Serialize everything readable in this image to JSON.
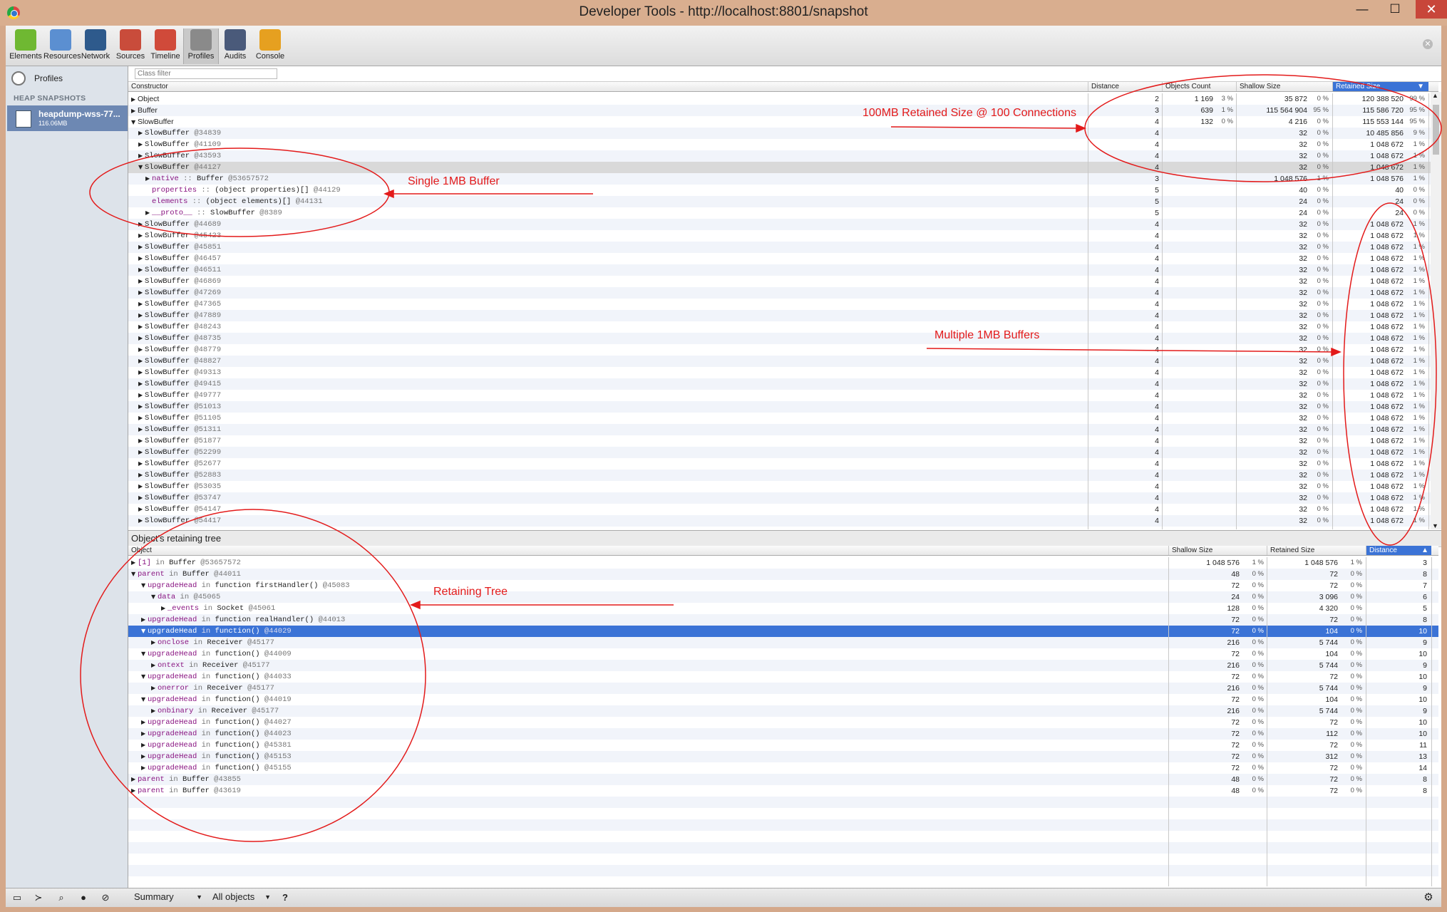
{
  "window": {
    "title": "Developer Tools - http://localhost:8801/snapshot",
    "controls": {
      "minimize": "—",
      "maximize": "☐",
      "close": "✕"
    }
  },
  "toolbar": {
    "items": [
      {
        "label": "Elements",
        "icon": "elements-icon",
        "color": "#6fb832"
      },
      {
        "label": "Resources",
        "icon": "resources-icon",
        "color": "#5b8fd1"
      },
      {
        "label": "Network",
        "icon": "network-icon",
        "color": "#2e5a8c"
      },
      {
        "label": "Sources",
        "icon": "sources-icon",
        "color": "#c94c3b"
      },
      {
        "label": "Timeline",
        "icon": "timeline-icon",
        "color": "#d04a3a"
      },
      {
        "label": "Profiles",
        "icon": "profiles-icon",
        "color": "#8a8a8a"
      },
      {
        "label": "Audits",
        "icon": "audits-icon",
        "color": "#4a5a7a"
      },
      {
        "label": "Console",
        "icon": "console-icon",
        "color": "#e6a020"
      }
    ],
    "active": "Profiles",
    "close": "✕"
  },
  "sidebar": {
    "profiles_label": "Profiles",
    "heading": "HEAP SNAPSHOTS",
    "snapshot": {
      "name": "heapdump-wss-77...",
      "size": "116.06MB"
    }
  },
  "filter": {
    "placeholder": "Class filter"
  },
  "summary": {
    "columns": {
      "constructor": "Constructor",
      "distance": "Distance",
      "count": "Objects Count",
      "shallow": "Shallow Size",
      "retained": "Retained Size",
      "sort_arrow": "▼"
    },
    "rows": [
      {
        "arrow": "▶",
        "indent": 0,
        "name": "Object",
        "mono": false,
        "distance": "2",
        "count": "1 169",
        "count_pct": "3 %",
        "shallow": "35 872",
        "shallow_pct": "0 %",
        "retained": "120 388 520",
        "retained_pct": "99 %"
      },
      {
        "arrow": "▶",
        "indent": 0,
        "name": "Buffer",
        "mono": false,
        "distance": "3",
        "count": "639",
        "count_pct": "1 %",
        "shallow": "115 564 904",
        "shallow_pct": "95 %",
        "retained": "115 586 720",
        "retained_pct": "95 %"
      },
      {
        "arrow": "▼",
        "indent": 0,
        "name": "SlowBuffer",
        "mono": false,
        "distance": "4",
        "count": "132",
        "count_pct": "0 %",
        "shallow": "4 216",
        "shallow_pct": "0 %",
        "retained": "115 553 144",
        "retained_pct": "95 %"
      },
      {
        "arrow": "▶",
        "indent": 1,
        "name": "SlowBuffer",
        "id": "@34839",
        "mono": true,
        "distance": "4",
        "shallow": "32",
        "shallow_pct": "0 %",
        "retained": "10 485 856",
        "retained_pct": "9 %"
      },
      {
        "arrow": "▶",
        "indent": 1,
        "name": "SlowBuffer",
        "id": "@41109",
        "mono": true,
        "distance": "4",
        "shallow": "32",
        "shallow_pct": "0 %",
        "retained": "1 048 672",
        "retained_pct": "1 %"
      },
      {
        "arrow": "▶",
        "indent": 1,
        "name": "SlowBuffer",
        "id": "@43593",
        "mono": true,
        "distance": "4",
        "shallow": "32",
        "shallow_pct": "0 %",
        "retained": "1 048 672",
        "retained_pct": "1 %"
      },
      {
        "arrow": "▼",
        "indent": 1,
        "name": "SlowBuffer",
        "id": "@44127",
        "mono": true,
        "highlight": true,
        "distance": "4",
        "shallow": "32",
        "shallow_pct": "0 %",
        "retained": "1 048 672",
        "retained_pct": "1 %"
      },
      {
        "arrow": "▶",
        "indent": 2,
        "prop": "native",
        "sep": " :: ",
        "name": "Buffer",
        "id": "@53657572",
        "mono": true,
        "dim": true,
        "distance": "3",
        "shallow": "1 048 576",
        "shallow_pct": "1 %",
        "retained": "1 048 576",
        "retained_pct": "1 %"
      },
      {
        "arrow": "",
        "indent": 2,
        "prop": "properties",
        "sep": " :: ",
        "name": "(object properties)[]",
        "id": "@44129",
        "mono": true,
        "dim": true,
        "distance": "5",
        "shallow": "40",
        "shallow_pct": "0 %",
        "retained": "40",
        "retained_pct": "0 %"
      },
      {
        "arrow": "",
        "indent": 2,
        "prop": "elements",
        "sep": " :: ",
        "name": "(object elements)[]",
        "id": "@44131",
        "mono": true,
        "dim": true,
        "distance": "5",
        "shallow": "24",
        "shallow_pct": "0 %",
        "retained": "24",
        "retained_pct": "0 %"
      },
      {
        "arrow": "▶",
        "indent": 2,
        "prop": "__proto__",
        "sep": " :: ",
        "name": "SlowBuffer",
        "id": "@8389",
        "mono": true,
        "dim": true,
        "distance": "5",
        "shallow": "24",
        "shallow_pct": "0 %",
        "retained": "24",
        "retained_pct": "0 %"
      },
      {
        "arrow": "▶",
        "indent": 1,
        "name": "SlowBuffer",
        "id": "@44689",
        "mono": true,
        "distance": "4",
        "shallow": "32",
        "shallow_pct": "0 %",
        "retained": "1 048 672",
        "retained_pct": "1 %"
      },
      {
        "arrow": "▶",
        "indent": 1,
        "name": "SlowBuffer",
        "id": "@45423",
        "mono": true,
        "distance": "4",
        "shallow": "32",
        "shallow_pct": "0 %",
        "retained": "1 048 672",
        "retained_pct": "1 %"
      },
      {
        "arrow": "▶",
        "indent": 1,
        "name": "SlowBuffer",
        "id": "@45851",
        "mono": true,
        "distance": "4",
        "shallow": "32",
        "shallow_pct": "0 %",
        "retained": "1 048 672",
        "retained_pct": "1 %"
      },
      {
        "arrow": "▶",
        "indent": 1,
        "name": "SlowBuffer",
        "id": "@46457",
        "mono": true,
        "distance": "4",
        "shallow": "32",
        "shallow_pct": "0 %",
        "retained": "1 048 672",
        "retained_pct": "1 %"
      },
      {
        "arrow": "▶",
        "indent": 1,
        "name": "SlowBuffer",
        "id": "@46511",
        "mono": true,
        "distance": "4",
        "shallow": "32",
        "shallow_pct": "0 %",
        "retained": "1 048 672",
        "retained_pct": "1 %"
      },
      {
        "arrow": "▶",
        "indent": 1,
        "name": "SlowBuffer",
        "id": "@46869",
        "mono": true,
        "distance": "4",
        "shallow": "32",
        "shallow_pct": "0 %",
        "retained": "1 048 672",
        "retained_pct": "1 %"
      },
      {
        "arrow": "▶",
        "indent": 1,
        "name": "SlowBuffer",
        "id": "@47269",
        "mono": true,
        "distance": "4",
        "shallow": "32",
        "shallow_pct": "0 %",
        "retained": "1 048 672",
        "retained_pct": "1 %"
      },
      {
        "arrow": "▶",
        "indent": 1,
        "name": "SlowBuffer",
        "id": "@47365",
        "mono": true,
        "distance": "4",
        "shallow": "32",
        "shallow_pct": "0 %",
        "retained": "1 048 672",
        "retained_pct": "1 %"
      },
      {
        "arrow": "▶",
        "indent": 1,
        "name": "SlowBuffer",
        "id": "@47889",
        "mono": true,
        "distance": "4",
        "shallow": "32",
        "shallow_pct": "0 %",
        "retained": "1 048 672",
        "retained_pct": "1 %"
      },
      {
        "arrow": "▶",
        "indent": 1,
        "name": "SlowBuffer",
        "id": "@48243",
        "mono": true,
        "distance": "4",
        "shallow": "32",
        "shallow_pct": "0 %",
        "retained": "1 048 672",
        "retained_pct": "1 %"
      },
      {
        "arrow": "▶",
        "indent": 1,
        "name": "SlowBuffer",
        "id": "@48735",
        "mono": true,
        "distance": "4",
        "shallow": "32",
        "shallow_pct": "0 %",
        "retained": "1 048 672",
        "retained_pct": "1 %"
      },
      {
        "arrow": "▶",
        "indent": 1,
        "name": "SlowBuffer",
        "id": "@48779",
        "mono": true,
        "distance": "4",
        "shallow": "32",
        "shallow_pct": "0 %",
        "retained": "1 048 672",
        "retained_pct": "1 %"
      },
      {
        "arrow": "▶",
        "indent": 1,
        "name": "SlowBuffer",
        "id": "@48827",
        "mono": true,
        "distance": "4",
        "shallow": "32",
        "shallow_pct": "0 %",
        "retained": "1 048 672",
        "retained_pct": "1 %"
      },
      {
        "arrow": "▶",
        "indent": 1,
        "name": "SlowBuffer",
        "id": "@49313",
        "mono": true,
        "distance": "4",
        "shallow": "32",
        "shallow_pct": "0 %",
        "retained": "1 048 672",
        "retained_pct": "1 %"
      },
      {
        "arrow": "▶",
        "indent": 1,
        "name": "SlowBuffer",
        "id": "@49415",
        "mono": true,
        "distance": "4",
        "shallow": "32",
        "shallow_pct": "0 %",
        "retained": "1 048 672",
        "retained_pct": "1 %"
      },
      {
        "arrow": "▶",
        "indent": 1,
        "name": "SlowBuffer",
        "id": "@49777",
        "mono": true,
        "distance": "4",
        "shallow": "32",
        "shallow_pct": "0 %",
        "retained": "1 048 672",
        "retained_pct": "1 %"
      },
      {
        "arrow": "▶",
        "indent": 1,
        "name": "SlowBuffer",
        "id": "@51013",
        "mono": true,
        "distance": "4",
        "shallow": "32",
        "shallow_pct": "0 %",
        "retained": "1 048 672",
        "retained_pct": "1 %"
      },
      {
        "arrow": "▶",
        "indent": 1,
        "name": "SlowBuffer",
        "id": "@51105",
        "mono": true,
        "distance": "4",
        "shallow": "32",
        "shallow_pct": "0 %",
        "retained": "1 048 672",
        "retained_pct": "1 %"
      },
      {
        "arrow": "▶",
        "indent": 1,
        "name": "SlowBuffer",
        "id": "@51311",
        "mono": true,
        "distance": "4",
        "shallow": "32",
        "shallow_pct": "0 %",
        "retained": "1 048 672",
        "retained_pct": "1 %"
      },
      {
        "arrow": "▶",
        "indent": 1,
        "name": "SlowBuffer",
        "id": "@51877",
        "mono": true,
        "distance": "4",
        "shallow": "32",
        "shallow_pct": "0 %",
        "retained": "1 048 672",
        "retained_pct": "1 %"
      },
      {
        "arrow": "▶",
        "indent": 1,
        "name": "SlowBuffer",
        "id": "@52299",
        "mono": true,
        "distance": "4",
        "shallow": "32",
        "shallow_pct": "0 %",
        "retained": "1 048 672",
        "retained_pct": "1 %"
      },
      {
        "arrow": "▶",
        "indent": 1,
        "name": "SlowBuffer",
        "id": "@52677",
        "mono": true,
        "distance": "4",
        "shallow": "32",
        "shallow_pct": "0 %",
        "retained": "1 048 672",
        "retained_pct": "1 %"
      },
      {
        "arrow": "▶",
        "indent": 1,
        "name": "SlowBuffer",
        "id": "@52883",
        "mono": true,
        "distance": "4",
        "shallow": "32",
        "shallow_pct": "0 %",
        "retained": "1 048 672",
        "retained_pct": "1 %"
      },
      {
        "arrow": "▶",
        "indent": 1,
        "name": "SlowBuffer",
        "id": "@53035",
        "mono": true,
        "distance": "4",
        "shallow": "32",
        "shallow_pct": "0 %",
        "retained": "1 048 672",
        "retained_pct": "1 %"
      },
      {
        "arrow": "▶",
        "indent": 1,
        "name": "SlowBuffer",
        "id": "@53747",
        "mono": true,
        "distance": "4",
        "shallow": "32",
        "shallow_pct": "0 %",
        "retained": "1 048 672",
        "retained_pct": "1 %"
      },
      {
        "arrow": "▶",
        "indent": 1,
        "name": "SlowBuffer",
        "id": "@54147",
        "mono": true,
        "distance": "4",
        "shallow": "32",
        "shallow_pct": "0 %",
        "retained": "1 048 672",
        "retained_pct": "1 %"
      },
      {
        "arrow": "▶",
        "indent": 1,
        "name": "SlowBuffer",
        "id": "@54417",
        "mono": true,
        "distance": "4",
        "shallow": "32",
        "shallow_pct": "0 %",
        "retained": "1 048 672",
        "retained_pct": "1 %"
      }
    ]
  },
  "retainers": {
    "title": "Object's retaining tree",
    "columns": {
      "object": "Object",
      "shallow": "Shallow Size",
      "retained": "Retained Size",
      "distance": "Distance",
      "sort_arrow": "▲"
    },
    "rows": [
      {
        "arrow": "▶",
        "indent": 0,
        "prop": "[1]",
        "kw": " in ",
        "name": "Buffer",
        "id": "@53657572",
        "shallow": "1 048 576",
        "shallow_pct": "1 %",
        "retained": "1 048 576",
        "retained_pct": "1 %",
        "distance": "3"
      },
      {
        "arrow": "▼",
        "indent": 0,
        "prop": "parent",
        "kw": " in ",
        "name": "Buffer",
        "id": "@44011",
        "shallow": "48",
        "shallow_pct": "0 %",
        "retained": "72",
        "retained_pct": "0 %",
        "distance": "8"
      },
      {
        "arrow": "▼",
        "indent": 1,
        "prop": "upgradeHead",
        "kw": " in ",
        "name": "function firstHandler()",
        "id": "@45083",
        "shallow": "72",
        "shallow_pct": "0 %",
        "retained": "72",
        "retained_pct": "0 %",
        "distance": "7"
      },
      {
        "arrow": "▼",
        "indent": 2,
        "prop": "data",
        "kw": " in ",
        "name": "",
        "id": "@45065",
        "shallow": "24",
        "shallow_pct": "0 %",
        "retained": "3 096",
        "retained_pct": "0 %",
        "distance": "6"
      },
      {
        "arrow": "▶",
        "indent": 3,
        "prop": "_events",
        "kw": " in ",
        "name": "Socket",
        "id": "@45061",
        "shallow": "128",
        "shallow_pct": "0 %",
        "retained": "4 320",
        "retained_pct": "0 %",
        "distance": "5"
      },
      {
        "arrow": "▶",
        "indent": 1,
        "prop": "upgradeHead",
        "kw": " in ",
        "name": "function realHandler()",
        "id": "@44013",
        "shallow": "72",
        "shallow_pct": "0 %",
        "retained": "72",
        "retained_pct": "0 %",
        "distance": "8"
      },
      {
        "arrow": "▼",
        "indent": 1,
        "prop": "upgradeHead",
        "kw": " in ",
        "name": "function()",
        "id": "@44029",
        "selected": true,
        "shallow": "72",
        "shallow_pct": "0 %",
        "retained": "104",
        "retained_pct": "0 %",
        "distance": "10"
      },
      {
        "arrow": "▶",
        "indent": 2,
        "prop": "onclose",
        "kw": " in ",
        "name": "Receiver",
        "id": "@45177",
        "shallow": "216",
        "shallow_pct": "0 %",
        "retained": "5 744",
        "retained_pct": "0 %",
        "distance": "9"
      },
      {
        "arrow": "▼",
        "indent": 1,
        "prop": "upgradeHead",
        "kw": " in ",
        "name": "function()",
        "id": "@44009",
        "shallow": "72",
        "shallow_pct": "0 %",
        "retained": "104",
        "retained_pct": "0 %",
        "distance": "10"
      },
      {
        "arrow": "▶",
        "indent": 2,
        "prop": "ontext",
        "kw": " in ",
        "name": "Receiver",
        "id": "@45177",
        "shallow": "216",
        "shallow_pct": "0 %",
        "retained": "5 744",
        "retained_pct": "0 %",
        "distance": "9"
      },
      {
        "arrow": "▼",
        "indent": 1,
        "prop": "upgradeHead",
        "kw": " in ",
        "name": "function()",
        "id": "@44033",
        "shallow": "72",
        "shallow_pct": "0 %",
        "retained": "72",
        "retained_pct": "0 %",
        "distance": "10"
      },
      {
        "arrow": "▶",
        "indent": 2,
        "prop": "onerror",
        "kw": " in ",
        "name": "Receiver",
        "id": "@45177",
        "shallow": "216",
        "shallow_pct": "0 %",
        "retained": "5 744",
        "retained_pct": "0 %",
        "distance": "9"
      },
      {
        "arrow": "▼",
        "indent": 1,
        "prop": "upgradeHead",
        "kw": " in ",
        "name": "function()",
        "id": "@44019",
        "shallow": "72",
        "shallow_pct": "0 %",
        "retained": "104",
        "retained_pct": "0 %",
        "distance": "10"
      },
      {
        "arrow": "▶",
        "indent": 2,
        "prop": "onbinary",
        "kw": " in ",
        "name": "Receiver",
        "id": "@45177",
        "shallow": "216",
        "shallow_pct": "0 %",
        "retained": "5 744",
        "retained_pct": "0 %",
        "distance": "9"
      },
      {
        "arrow": "▶",
        "indent": 1,
        "prop": "upgradeHead",
        "kw": " in ",
        "name": "function()",
        "id": "@44027",
        "shallow": "72",
        "shallow_pct": "0 %",
        "retained": "72",
        "retained_pct": "0 %",
        "distance": "10"
      },
      {
        "arrow": "▶",
        "indent": 1,
        "prop": "upgradeHead",
        "kw": " in ",
        "name": "function()",
        "id": "@44023",
        "shallow": "72",
        "shallow_pct": "0 %",
        "retained": "112",
        "retained_pct": "0 %",
        "distance": "10"
      },
      {
        "arrow": "▶",
        "indent": 1,
        "prop": "upgradeHead",
        "kw": " in ",
        "name": "function()",
        "id": "@45381",
        "shallow": "72",
        "shallow_pct": "0 %",
        "retained": "72",
        "retained_pct": "0 %",
        "distance": "11"
      },
      {
        "arrow": "▶",
        "indent": 1,
        "prop": "upgradeHead",
        "kw": " in ",
        "name": "function()",
        "id": "@45153",
        "shallow": "72",
        "shallow_pct": "0 %",
        "retained": "312",
        "retained_pct": "0 %",
        "distance": "13"
      },
      {
        "arrow": "▶",
        "indent": 1,
        "prop": "upgradeHead",
        "kw": " in ",
        "name": "function()",
        "id": "@45155",
        "shallow": "72",
        "shallow_pct": "0 %",
        "retained": "72",
        "retained_pct": "0 %",
        "distance": "14"
      },
      {
        "arrow": "▶",
        "indent": 0,
        "prop": "parent",
        "kw": " in ",
        "name": "Buffer",
        "id": "@43855",
        "shallow": "48",
        "shallow_pct": "0 %",
        "retained": "72",
        "retained_pct": "0 %",
        "distance": "8"
      },
      {
        "arrow": "▶",
        "indent": 0,
        "prop": "parent",
        "kw": " in ",
        "name": "Buffer",
        "id": "@43619",
        "shallow": "48",
        "shallow_pct": "0 %",
        "retained": "72",
        "retained_pct": "0 %",
        "distance": "8"
      }
    ]
  },
  "statusbar": {
    "view_select": "Summary",
    "filter_select": "All objects",
    "help": "?",
    "icons": [
      "dock-icon",
      "console-drawer-icon",
      "search-icon",
      "record-icon",
      "clear-icon",
      "settings-icon"
    ]
  },
  "annotations": {
    "retained_note": "100MB Retained Size @ 100 Connections",
    "single_note": "Single 1MB Buffer",
    "multiple_note": "Multiple 1MB Buffers",
    "tree_note": "Retaining Tree",
    "color": "#e31a1a"
  }
}
